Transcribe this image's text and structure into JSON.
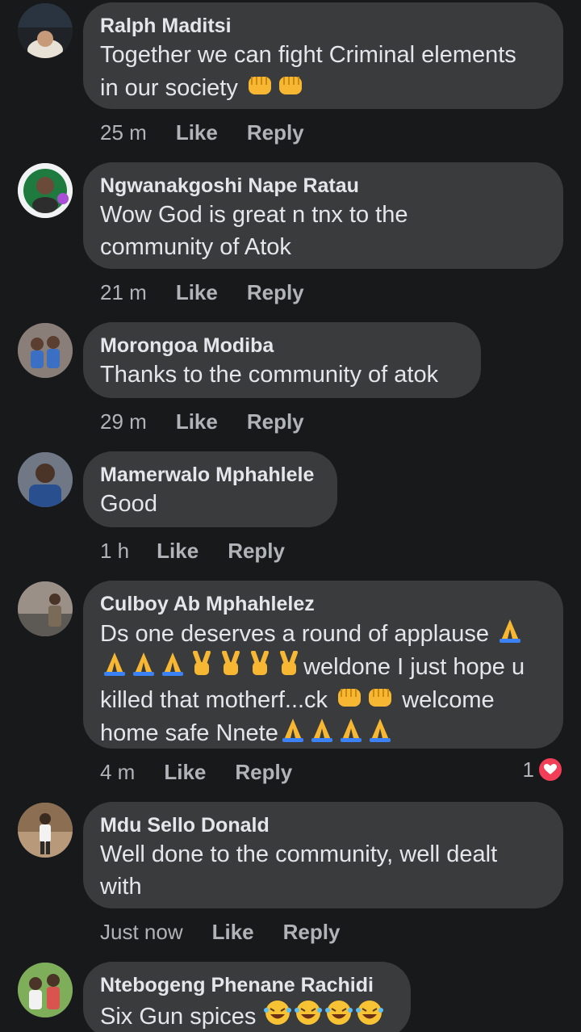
{
  "actions": {
    "like": "Like",
    "reply": "Reply"
  },
  "colors": {
    "background": "#18191a",
    "bubble": "#3a3b3c",
    "heart": "#f33e58"
  },
  "comments": [
    {
      "author": "Ralph Maditsi",
      "lines": [
        "Together we can fight Criminal elements",
        "in our society"
      ],
      "line_emojis": [
        [],
        [
          "fist-emoji",
          "fist-emoji"
        ]
      ],
      "time": "25 m"
    },
    {
      "author": "Ngwanakgoshi Nape Ratau",
      "lines": [
        "Wow God is great n tnx to the",
        "community of Atok"
      ],
      "time": "21 m"
    },
    {
      "author": "Morongoa Modiba",
      "lines": [
        "Thanks to the community of atok"
      ],
      "time": "29 m"
    },
    {
      "author": "Mamerwalo Mphahlele",
      "lines": [
        "Good"
      ],
      "time": "1 h"
    },
    {
      "author": "Culboy Ab Mphahlelez",
      "lines": [
        "Ds one deserves a round of applause",
        "weldone I just hope u",
        "killed that motherf...ck",
        "welcome",
        "home safe Nnete"
      ],
      "time": "4 m",
      "reaction_count": "1",
      "reaction_icon": "heart-reaction-icon"
    },
    {
      "author": "Mdu Sello Donald",
      "lines": [
        "Well done to the community, well dealt",
        "with"
      ],
      "time": "Just now"
    },
    {
      "author": "Ntebogeng Phenane Rachidi",
      "lines": [
        "Six Gun spices"
      ],
      "line_emojis": [
        [
          "laughing-emoji",
          "laughing-emoji",
          "laughing-emoji",
          "laughing-emoji"
        ]
      ]
    }
  ]
}
